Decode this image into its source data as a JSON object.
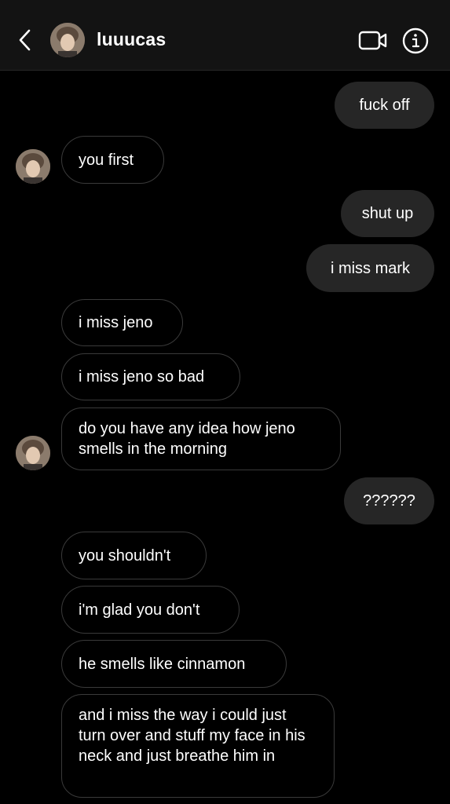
{
  "header": {
    "username": "luuucas",
    "back_icon": "chevron-left-icon",
    "video_icon": "video-camera-icon",
    "info_icon": "info-icon"
  },
  "colors": {
    "background": "#000000",
    "header_bg": "#131313",
    "sent_bubble": "#262626",
    "received_border": "#3a3a3a",
    "text": "#ffffff"
  },
  "messages": [
    {
      "side": "sent",
      "text": "fuck off"
    },
    {
      "side": "received",
      "text": "you first"
    },
    {
      "side": "sent",
      "text": "shut up"
    },
    {
      "side": "sent",
      "text": "i miss mark"
    },
    {
      "side": "received",
      "text": "i miss jeno"
    },
    {
      "side": "received",
      "text": "i miss jeno so bad"
    },
    {
      "side": "received",
      "text": "do you have any idea how jeno smells in the morning"
    },
    {
      "side": "sent",
      "text": "??????"
    },
    {
      "side": "received",
      "text": "you shouldn't"
    },
    {
      "side": "received",
      "text": "i'm glad you don't"
    },
    {
      "side": "received",
      "text": "he smells like cinnamon"
    },
    {
      "side": "received",
      "text": "and i miss the way i could just turn over and stuff my face in his neck and just breathe him in"
    }
  ]
}
